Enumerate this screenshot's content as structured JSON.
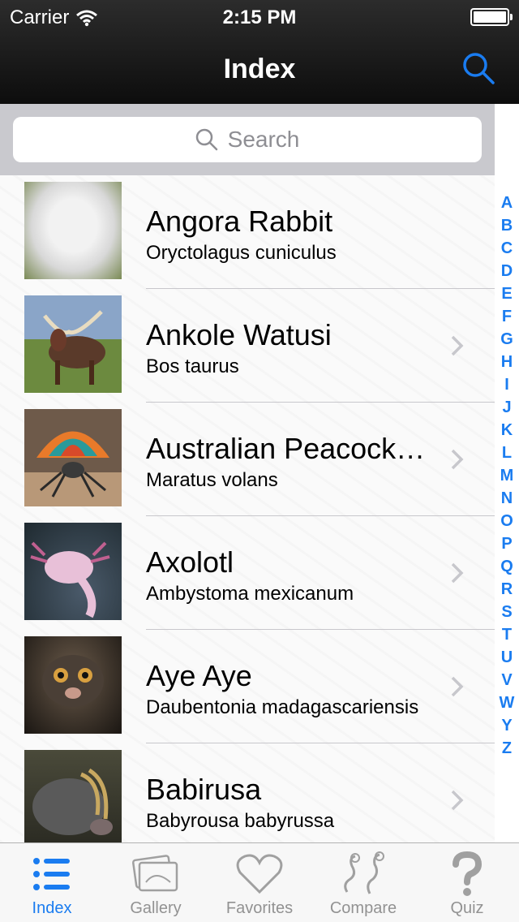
{
  "status": {
    "carrier": "Carrier",
    "time": "2:15 PM"
  },
  "nav": {
    "title": "Index"
  },
  "search": {
    "placeholder": "Search"
  },
  "rows": [
    {
      "title": "Angora Rabbit",
      "subtitle": "Oryctolagus cuniculus",
      "chevron": false
    },
    {
      "title": "Ankole Watusi",
      "subtitle": "Bos taurus",
      "chevron": true
    },
    {
      "title": "Australian Peacock…",
      "subtitle": "Maratus volans",
      "chevron": true
    },
    {
      "title": "Axolotl",
      "subtitle": "Ambystoma mexicanum",
      "chevron": true
    },
    {
      "title": "Aye Aye",
      "subtitle": "Daubentonia madagascariensis",
      "chevron": true
    },
    {
      "title": "Babirusa",
      "subtitle": "Babyrousa babyrussa",
      "chevron": true
    }
  ],
  "index_letters": [
    "A",
    "B",
    "C",
    "D",
    "E",
    "F",
    "G",
    "H",
    "I",
    "J",
    "K",
    "L",
    "M",
    "N",
    "O",
    "P",
    "Q",
    "R",
    "S",
    "T",
    "U",
    "V",
    "W",
    "Y",
    "Z"
  ],
  "tabs": [
    {
      "label": "Index",
      "icon": "list-icon",
      "active": true
    },
    {
      "label": "Gallery",
      "icon": "gallery-icon",
      "active": false
    },
    {
      "label": "Favorites",
      "icon": "heart-icon",
      "active": false
    },
    {
      "label": "Compare",
      "icon": "compare-icon",
      "active": false
    },
    {
      "label": "Quiz",
      "icon": "question-icon",
      "active": false
    }
  ],
  "colors": {
    "accent": "#1a7cf0",
    "inactive": "#929292",
    "navbar": "#1a1a1a"
  }
}
